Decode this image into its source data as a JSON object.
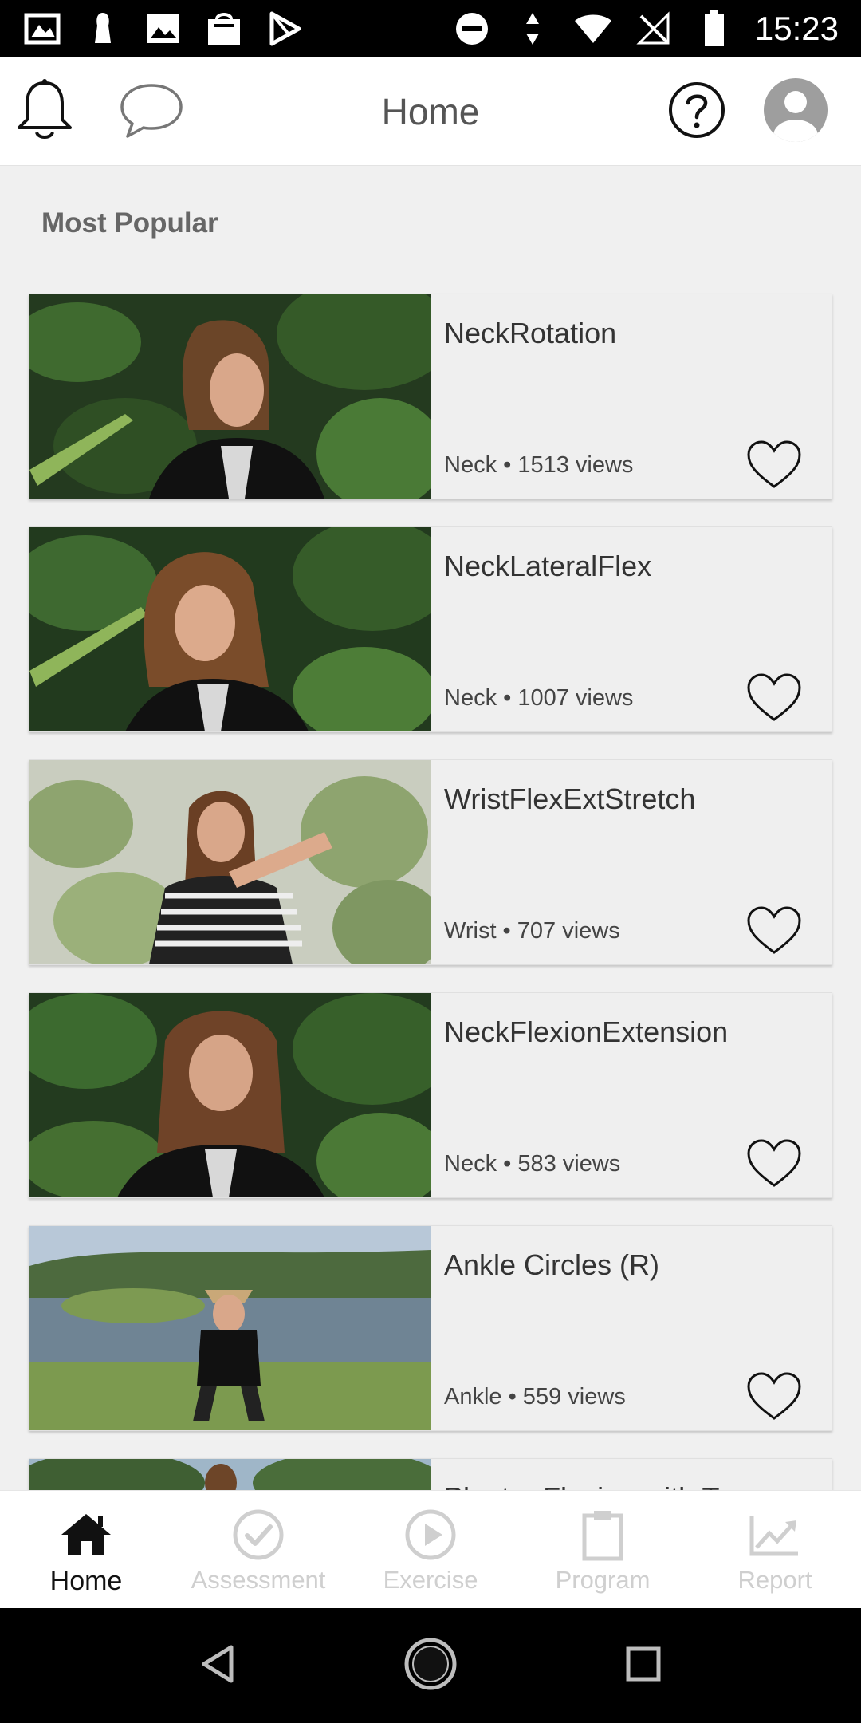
{
  "status_bar": {
    "time": "15:23"
  },
  "header": {
    "title": "Home"
  },
  "section": {
    "title": "Most Popular"
  },
  "cards": [
    {
      "title": "NeckRotation",
      "meta": "Neck • 1513 views"
    },
    {
      "title": "NeckLateralFlex",
      "meta": "Neck • 1007 views"
    },
    {
      "title": "WristFlexExtStretch",
      "meta": "Wrist • 707 views"
    },
    {
      "title": "NeckFlexionExtension",
      "meta": "Neck • 583 views"
    },
    {
      "title": "Ankle Circles (R)",
      "meta": "Ankle • 559 views"
    },
    {
      "title": "Plantar Flexion with T",
      "meta": ""
    }
  ],
  "bottom_nav": [
    {
      "label": "Home",
      "icon": "home-icon",
      "active": true
    },
    {
      "label": "Assessment",
      "icon": "check-circle-icon",
      "active": false
    },
    {
      "label": "Exercise",
      "icon": "play-circle-icon",
      "active": false
    },
    {
      "label": "Program",
      "icon": "clipboard-icon",
      "active": false
    },
    {
      "label": "Report",
      "icon": "trending-chart-icon",
      "active": false
    }
  ],
  "colors": {
    "accent": "#111111",
    "inactive": "#cfcfcf",
    "card_bg": "#efefef",
    "title_text": "#555555"
  }
}
